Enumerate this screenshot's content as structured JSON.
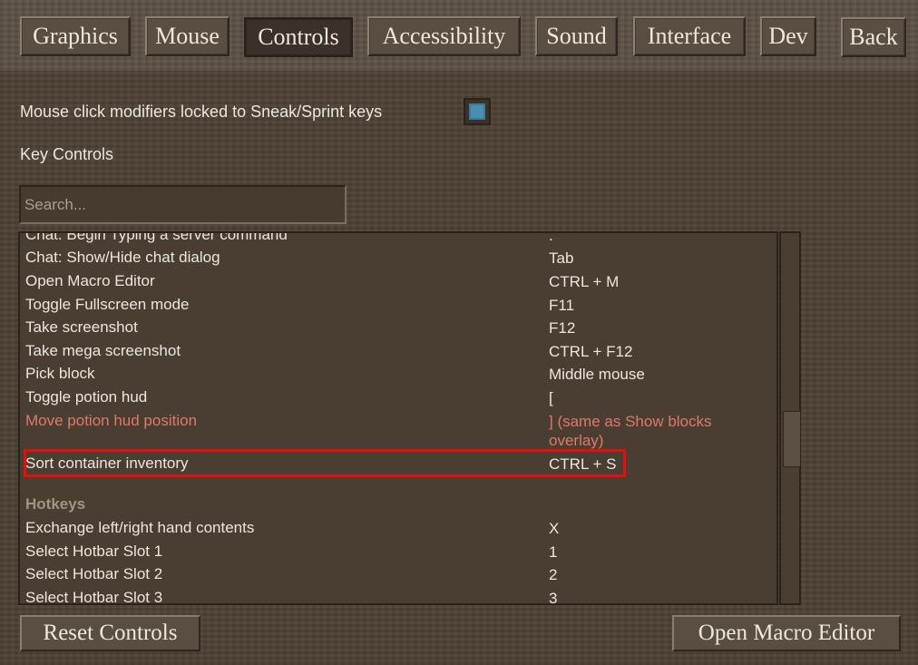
{
  "tabs": [
    {
      "label": "Graphics"
    },
    {
      "label": "Mouse"
    },
    {
      "label": "Controls"
    },
    {
      "label": "Accessibility"
    },
    {
      "label": "Sound"
    },
    {
      "label": "Interface"
    },
    {
      "label": "Dev"
    }
  ],
  "active_tab": "Controls",
  "back_label": "Back",
  "settings": {
    "mouse_modifier_label": "Mouse click modifiers locked to Sneak/Sprint keys",
    "mouse_modifier_checked": true,
    "key_controls_title": "Key Controls"
  },
  "search": {
    "placeholder": "Search..."
  },
  "keybinds": [
    {
      "label": "Chat: Begin Typing a server command",
      "key": "."
    },
    {
      "label": "Chat: Show/Hide chat dialog",
      "key": "Tab"
    },
    {
      "label": "Open Macro Editor",
      "key": "CTRL + M"
    },
    {
      "label": "Toggle Fullscreen mode",
      "key": "F11"
    },
    {
      "label": "Take screenshot",
      "key": "F12"
    },
    {
      "label": "Take mega screenshot",
      "key": "CTRL + F12"
    },
    {
      "label": "Pick block",
      "key": "Middle mouse"
    },
    {
      "label": "Toggle potion hud",
      "key": "["
    },
    {
      "label": "Move potion hud position",
      "key": "] (same as Show blocks overlay)"
    },
    {
      "label": "Sort container inventory",
      "key": "CTRL + S"
    },
    {
      "label": "Hotkeys",
      "key": ""
    },
    {
      "label": "Exchange left/right hand contents",
      "key": "X"
    },
    {
      "label": "Select Hotbar Slot 1",
      "key": "1"
    },
    {
      "label": "Select Hotbar Slot 2",
      "key": "2"
    },
    {
      "label": "Select Hotbar Slot 3",
      "key": "3"
    }
  ],
  "footer": {
    "reset_label": "Reset Controls",
    "macro_label": "Open Macro Editor"
  },
  "colors": {
    "conflict_text": "#e0786a",
    "highlight_border": "#e01010",
    "checkbox_fill": "#4a8fb0"
  }
}
